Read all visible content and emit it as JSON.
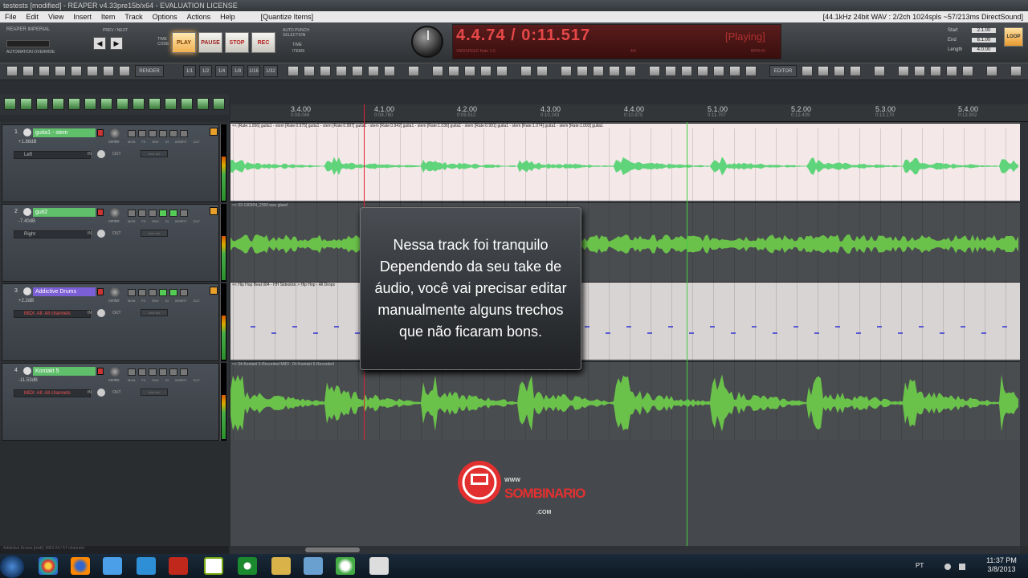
{
  "window": {
    "title": "testests [modified] - REAPER v4.33pre15b/x64 - EVALUATION LICENSE"
  },
  "menu": {
    "items": [
      "File",
      "Edit",
      "View",
      "Insert",
      "Item",
      "Track",
      "Options",
      "Actions",
      "Help",
      "[Quantize Items]"
    ],
    "status_right": "[44.1kHz 24bit WAV : 2/2ch 1024spls ~57/213ms DirectSound]"
  },
  "transport": {
    "brand": "REAPER IMPERIAL",
    "automation": "AUTOMATION OVERRIDE",
    "prevnext": "PREV / NEXT",
    "timecode": "TIME CODE",
    "play": "PLAY",
    "pause": "PAUSE",
    "stop": "STOP",
    "rec": "REC",
    "auto_punch": "AUTO PUNCH SELECTION",
    "punch_time": "TIME",
    "punch_items": "ITEMS",
    "time_display": "4.4.74 / 0:11.517",
    "state": "[Playing]",
    "varispeed": "VARISPEED   Rate   1.0",
    "bpm": "BPM   60",
    "signature": "4/4",
    "selection": {
      "start_label": "Start",
      "start": "2.1.00",
      "end_label": "End",
      "end": "6.1.00",
      "length_label": "Length",
      "length": "4.0.00"
    },
    "loop": "LOOP"
  },
  "toolbar": {
    "render": "RENDER",
    "grid": [
      "1/1",
      "1/2",
      "1/4",
      "1/8",
      "1/16",
      "1/32"
    ],
    "editor": "EDITOR"
  },
  "ruler": [
    {
      "bar": "3.4.00",
      "time": "0:08.048"
    },
    {
      "bar": "4.1.00",
      "time": "0:08.780"
    },
    {
      "bar": "4.2.00",
      "time": "0:09.512"
    },
    {
      "bar": "4.3.00",
      "time": "0:10.243"
    },
    {
      "bar": "4.4.00",
      "time": "0:10.975"
    },
    {
      "bar": "5.1.00",
      "time": "0:11.707"
    },
    {
      "bar": "5.2.00",
      "time": "0:12.439"
    },
    {
      "bar": "5.3.00",
      "time": "0:13.170"
    },
    {
      "bar": "5.4.00",
      "time": "0:13.902"
    }
  ],
  "tracks": [
    {
      "num": "1",
      "name": "guita1 - stem",
      "vol": "+1.88dB",
      "input": "Left",
      "color": "#5fbf6a"
    },
    {
      "num": "2",
      "name": "guit2",
      "vol": "-7.40dB",
      "input": "Right",
      "color": "#5fbf6a"
    },
    {
      "num": "3",
      "name": "Addictive Drums",
      "vol": "+2.2dB",
      "input": "MIDI: All: All channels",
      "color": "#7a5fd6"
    },
    {
      "num": "4",
      "name": "Kontakt 5",
      "vol": "-11.53dB",
      "input": "MIDI: All: All channels",
      "color": "#5fbf6a"
    }
  ],
  "track_labels": {
    "center": "center",
    "mon": "MON",
    "fx": "FX",
    "env": "ENV",
    "io": "IO",
    "insert": "INSERT",
    "cut": "CUT",
    "out": "OUT",
    "in": "IN",
    "time_sel": "time sel"
  },
  "items": [
    {
      "label": "<< [Rate:1.056] guita1 - stem   [Rate:0.975] guita1 - stem   [Rate:0.997] guita1 - stem   [Rate:0.942] guita1 - stem   [Rate:1.036] guita1 - stem   [Rate:0.991] guita1 - stem   [Rate:1.074] guita1 - stem   [Rate:1.003] guita1"
    },
    {
      "label": "<< 03-130304_2350.wav glued"
    },
    {
      "label": "<< Hip Hop Beat 084 - HH Sidestick > Hip Hop - All Drops"
    },
    {
      "label": "<< 04-Kontakt 5-Recorded MIDI : 04-Kontakt 5-Recorded"
    }
  ],
  "caption": [
    "Nessa track foi tranquilo",
    "Dependendo da seu take de",
    "áudio, você vai precisar editar",
    "manualmente alguns trechos",
    "que não ficaram bons."
  ],
  "logo": {
    "www": "WWW",
    "name": "SOMBINARIO",
    "com": ".COM"
  },
  "statusbar": "Addictive Drums [midi]: MIDI 24 / 57 channels",
  "taskbar": {
    "lang": "PT",
    "time": "11:37 PM",
    "date": "3/8/2013"
  }
}
